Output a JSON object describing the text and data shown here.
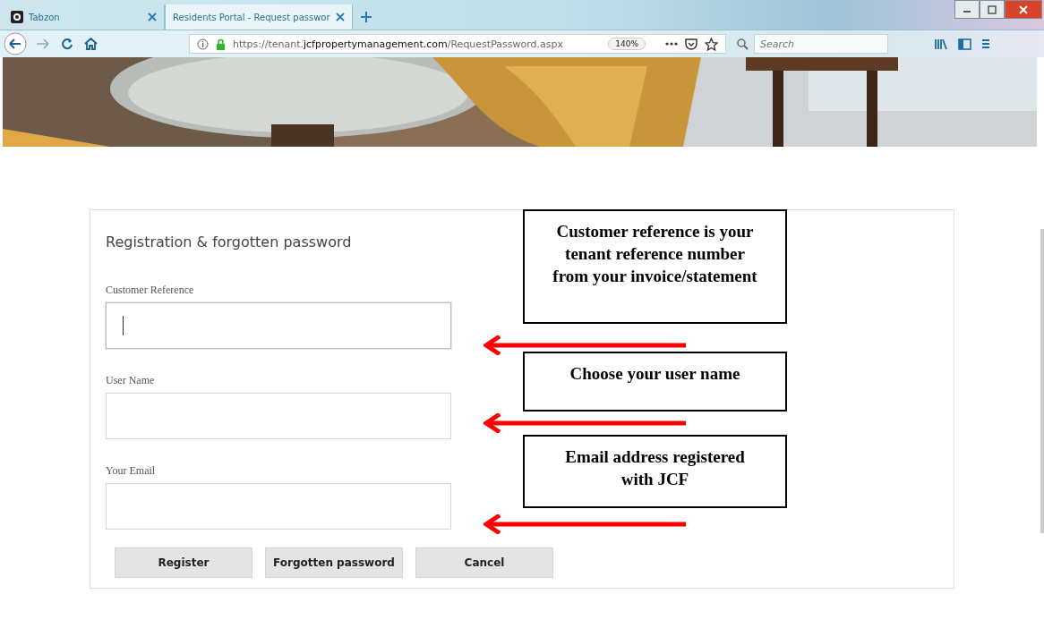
{
  "browser": {
    "tabs": [
      {
        "title": "Tabzon",
        "selected": false
      },
      {
        "title": "Residents Portal - Request passwor",
        "selected": true
      }
    ],
    "url": {
      "prefix": "https://tenant.",
      "domain": "jcfpropertymanagement.com",
      "path": "/RequestPassword.aspx"
    },
    "zoom": "140%",
    "search": {
      "placeholder": "Search"
    }
  },
  "form": {
    "title": "Registration & forgotten password",
    "fields": [
      {
        "label": "Customer Reference",
        "focused": true
      },
      {
        "label": "User Name",
        "focused": false
      },
      {
        "label": "Your Email",
        "focused": false
      }
    ],
    "buttons": [
      "Register",
      "Forgotten password",
      "Cancel"
    ]
  },
  "callouts": [
    "Customer reference is your tenant reference number from your invoice/statement",
    "Choose your user name",
    "Email address registered with JCF"
  ]
}
